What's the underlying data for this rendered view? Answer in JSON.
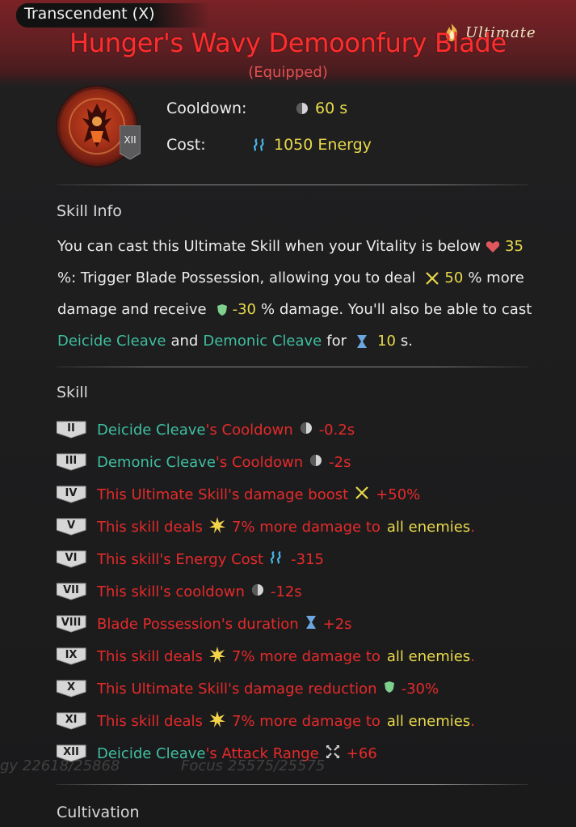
{
  "header": {
    "rank": "Transcendent (X)",
    "title": "Hunger's Wavy Demoonfury Blade",
    "status": "(Equipped)",
    "badge": "Ultimate"
  },
  "portrait": {
    "level": "XII"
  },
  "stats": {
    "cooldown_label": "Cooldown:",
    "cooldown_value": "60 s",
    "cost_label": "Cost:",
    "cost_value": "1050 Energy"
  },
  "skill_info": {
    "title": "Skill Info",
    "line1": {
      "text": "You can cast this Ultimate Skill when your Vitality is below",
      "value": "35"
    },
    "line2": {
      "prefix": "%: Trigger Blade Possession, allowing you to deal",
      "value": "50",
      "suffix": "% more"
    },
    "line3": {
      "prefix": "damage and receive",
      "value": "-30",
      "suffix": "% damage. You'll also be able to cast"
    },
    "line4": {
      "skill1": "Deicide Cleave",
      "and": "and",
      "skill2": "Demonic Cleave",
      "for": "for",
      "value": "10",
      "unit": "s."
    }
  },
  "skill": {
    "title": "Skill",
    "rows": [
      {
        "numeral": "II",
        "name": "Deicide Cleave",
        "text": "'s Cooldown",
        "icon": "cooldown-icon",
        "value": "-0.2s",
        "name_color": "#3fbfa0"
      },
      {
        "numeral": "III",
        "name": "Demonic Cleave",
        "text": "'s Cooldown",
        "icon": "cooldown-icon",
        "value": "-2s",
        "name_color": "#3fbfa0"
      },
      {
        "numeral": "IV",
        "text": "This Ultimate Skill's damage boost",
        "icon": "swords-icon",
        "value": "+50%"
      },
      {
        "numeral": "V",
        "text": "This skill deals",
        "icon": "burst-icon",
        "value": "7% more damage to",
        "target": "all enemies",
        "end": "."
      },
      {
        "numeral": "VI",
        "text": "This skill's Energy Cost",
        "icon": "energy-icon",
        "value": "-315"
      },
      {
        "numeral": "VII",
        "text": "This skill's cooldown",
        "icon": "cooldown-icon",
        "value": "-12s"
      },
      {
        "numeral": "VIII",
        "text": "Blade Possession's duration",
        "icon": "hourglass-icon",
        "value": "+2s"
      },
      {
        "numeral": "IX",
        "text": "This skill deals",
        "icon": "burst-icon",
        "value": "7% more damage to",
        "target": "all enemies",
        "end": "."
      },
      {
        "numeral": "X",
        "text": "This Ultimate Skill's damage reduction",
        "icon": "shield-icon",
        "value": "-30%"
      },
      {
        "numeral": "XI",
        "text": "This skill deals",
        "icon": "burst-icon",
        "value": "7% more damage to",
        "target": "all enemies",
        "end": "."
      },
      {
        "numeral": "XII",
        "name": "Deicide Cleave",
        "text": "'s Attack Range",
        "icon": "range-icon",
        "value": "+66",
        "name_color": "#3fbfa0"
      }
    ]
  },
  "cultivation": {
    "title": "Cultivation"
  },
  "background_hud": {
    "energy": "gy  22618/25868",
    "focus": "Focus  25575/25575"
  },
  "colors": {
    "title_red": "#ff2d2d",
    "value_yellow": "#e9d94a",
    "skill_teal": "#3fbfa0",
    "upgrade_red": "#e62a2a"
  }
}
